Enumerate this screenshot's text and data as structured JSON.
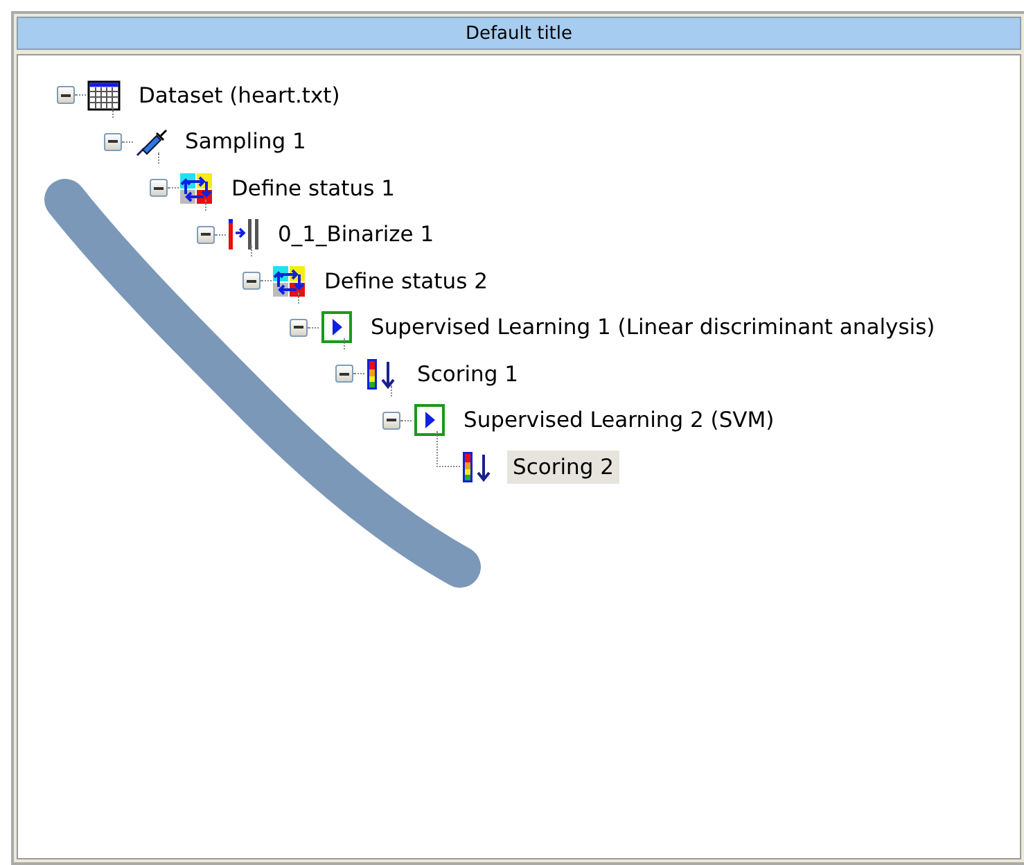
{
  "panel": {
    "title": "Default title"
  },
  "tree": [
    {
      "label": "Dataset (heart.txt)",
      "kind": "dataset",
      "expanded": true,
      "selected": false,
      "children": [
        {
          "label": "Sampling 1",
          "kind": "sampling",
          "expanded": true,
          "selected": false,
          "children": [
            {
              "label": "Define status 1",
              "kind": "status",
              "expanded": true,
              "selected": false,
              "children": [
                {
                  "label": "0_1_Binarize 1",
                  "kind": "binarize",
                  "expanded": true,
                  "selected": false,
                  "children": [
                    {
                      "label": "Define status 2",
                      "kind": "status",
                      "expanded": true,
                      "selected": false,
                      "children": [
                        {
                          "label": "Supervised Learning 1 (Linear discriminant analysis)",
                          "kind": "learning",
                          "expanded": true,
                          "selected": false,
                          "children": [
                            {
                              "label": "Scoring 1",
                              "kind": "scoring",
                              "expanded": true,
                              "selected": false,
                              "children": [
                                {
                                  "label": "Supervised Learning 2 (SVM)",
                                  "kind": "learning",
                                  "expanded": true,
                                  "selected": false,
                                  "children": [
                                    {
                                      "label": "Scoring 2",
                                      "kind": "scoring",
                                      "selected": true
                                    }
                                  ]
                                }
                              ]
                            }
                          ]
                        }
                      ]
                    }
                  ]
                }
              ]
            }
          ]
        }
      ]
    }
  ]
}
